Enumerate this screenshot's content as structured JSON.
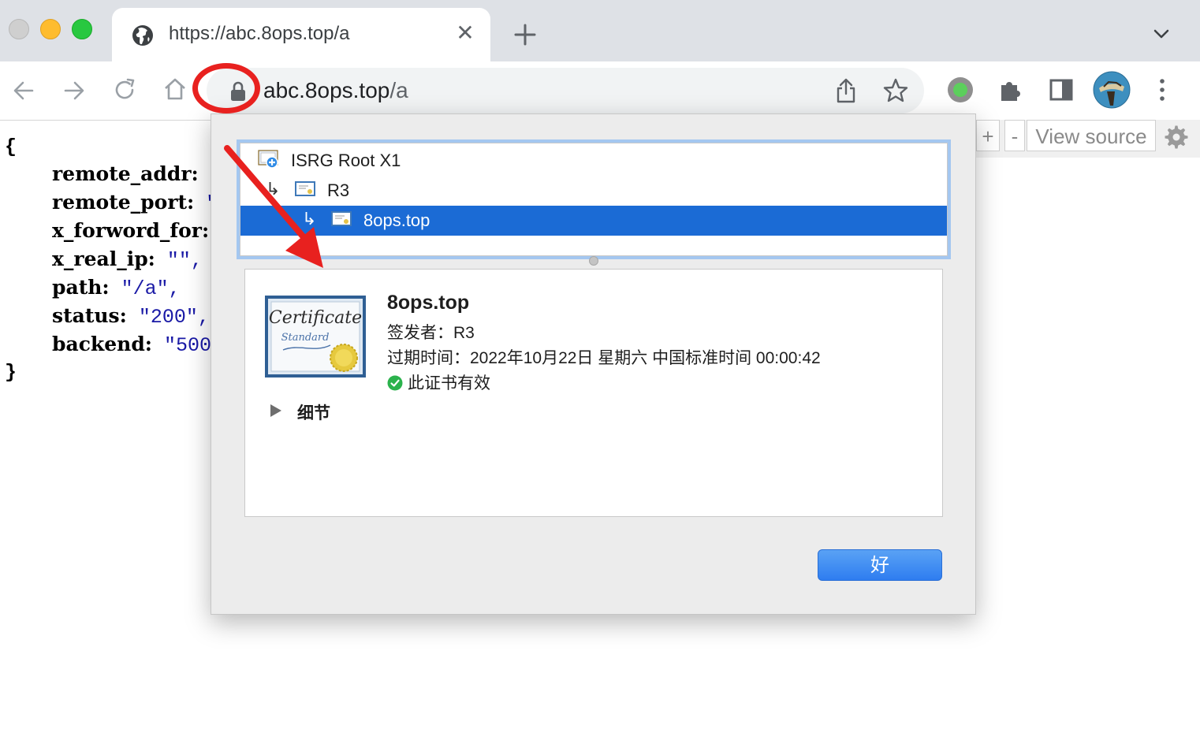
{
  "window": {
    "traffic_lights": [
      "close",
      "minimize",
      "zoom"
    ]
  },
  "tab": {
    "title": "https://abc.8ops.top/a",
    "close_glyph": "✕",
    "icon": "globe-icon"
  },
  "toolbar": {
    "url_host": "abc.8ops.top",
    "url_path": "/a",
    "icons": [
      "back-icon",
      "forward-icon",
      "reload-icon",
      "home-icon",
      "lock-icon",
      "share-icon",
      "star-icon",
      "extension-status-icon",
      "extensions-puzzle-icon",
      "side-panel-icon",
      "profile-avatar",
      "menu-icon"
    ]
  },
  "page": {
    "open_brace": "{",
    "close_brace": "}",
    "lines": [
      {
        "key": "remote_addr:",
        "value": "\""
      },
      {
        "key": "remote_port:",
        "value": "\""
      },
      {
        "key": "x_forword_for:",
        "value": ""
      },
      {
        "key": "x_real_ip:",
        "value": "\"\","
      },
      {
        "key": "path:",
        "value": "\"/a\","
      },
      {
        "key": "status:",
        "value": "\"200\","
      },
      {
        "key": "backend:",
        "value": "\"500:"
      }
    ],
    "json_viewer": {
      "plus": "+",
      "minus": "-",
      "view_source": "View source"
    }
  },
  "dialog": {
    "chain": [
      {
        "label": "ISRG Root X1",
        "selected": false,
        "level": 0
      },
      {
        "label": "R3",
        "selected": false,
        "level": 1
      },
      {
        "label": "8ops.top",
        "selected": true,
        "level": 2
      }
    ],
    "indent_glyph": "↳",
    "detail": {
      "name": "8ops.top",
      "issuer": "签发者：R3",
      "expires": "过期时间：2022年10月22日 星期六 中国标准时间 00:00:42",
      "status": "此证书有效",
      "details_label": "细节",
      "cert_image_text_1": "Certificate",
      "cert_image_text_2": "Standard"
    },
    "ok_label": "好"
  },
  "colors": {
    "selection": "#1b6bd5",
    "annotation_red": "#e8211f",
    "valid_green": "#2bb24c",
    "ok_button": "#2e7df0"
  }
}
